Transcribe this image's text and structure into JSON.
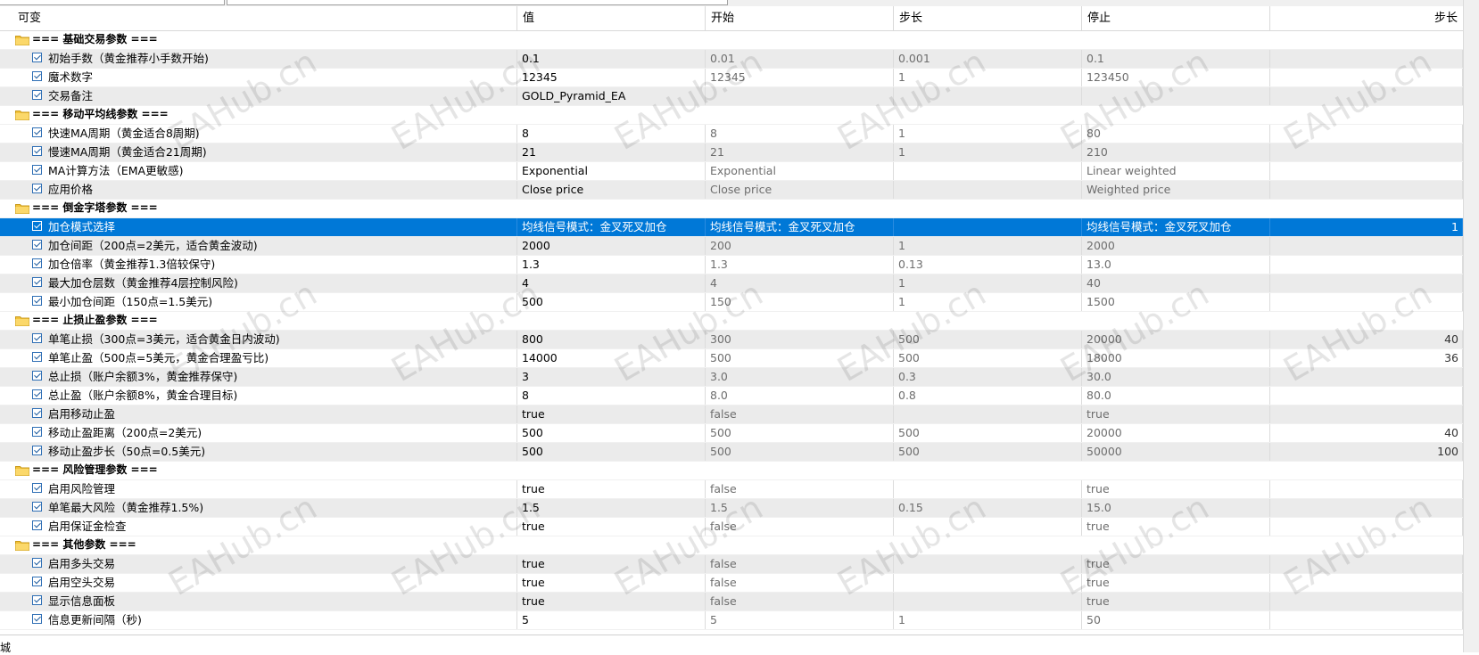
{
  "header": {
    "col_name": "可变",
    "col_value": "值",
    "col_start": "开始",
    "col_step": "步长",
    "col_stop": "停止",
    "col_step2": "步长"
  },
  "groups": [
    {
      "title": "=== 基础交易参数 ===",
      "params": [
        {
          "name": "初始手数（黄金推荐小手数开始)",
          "value": "0.1",
          "start": "0.01",
          "step": "0.001",
          "stop": "0.1",
          "step2": ""
        },
        {
          "name": "魔术数字",
          "value": "12345",
          "start": "12345",
          "step": "1",
          "stop": "123450",
          "step2": ""
        },
        {
          "name": "交易备注",
          "value": "GOLD_Pyramid_EA",
          "start": "",
          "step": "",
          "stop": "",
          "step2": ""
        }
      ]
    },
    {
      "title": "=== 移动平均线参数 ===",
      "params": [
        {
          "name": "快速MA周期（黄金适合8周期)",
          "value": "8",
          "start": "8",
          "step": "1",
          "stop": "80",
          "step2": ""
        },
        {
          "name": "慢速MA周期（黄金适合21周期)",
          "value": "21",
          "start": "21",
          "step": "1",
          "stop": "210",
          "step2": ""
        },
        {
          "name": "MA计算方法（EMA更敏感)",
          "value": "Exponential",
          "start": "Exponential",
          "step": "",
          "stop": "Linear weighted",
          "step2": ""
        },
        {
          "name": "应用价格",
          "value": "Close price",
          "start": "Close price",
          "step": "",
          "stop": "Weighted price",
          "step2": ""
        }
      ]
    },
    {
      "title": "=== 倒金字塔参数 ===",
      "params": [
        {
          "name": "加仓模式选择",
          "value": "均线信号模式：金叉死叉加仓",
          "start": "均线信号模式：金叉死叉加仓",
          "step": "",
          "stop": "均线信号模式：金叉死叉加仓",
          "step2": "1",
          "selected": true
        },
        {
          "name": "加仓间距（200点=2美元，适合黄金波动)",
          "value": "2000",
          "start": "200",
          "step": "1",
          "stop": "2000",
          "step2": ""
        },
        {
          "name": "加仓倍率（黄金推荐1.3倍较保守)",
          "value": "1.3",
          "start": "1.3",
          "step": "0.13",
          "stop": "13.0",
          "step2": ""
        },
        {
          "name": "最大加仓层数（黄金推荐4层控制风险)",
          "value": "4",
          "start": "4",
          "step": "1",
          "stop": "40",
          "step2": ""
        },
        {
          "name": "最小加仓间距（150点=1.5美元)",
          "value": "500",
          "start": "150",
          "step": "1",
          "stop": "1500",
          "step2": ""
        }
      ]
    },
    {
      "title": "=== 止损止盈参数 ===",
      "params": [
        {
          "name": "单笔止损（300点=3美元，适合黄金日内波动)",
          "value": "800",
          "start": "300",
          "step": "500",
          "stop": "20000",
          "step2": "40"
        },
        {
          "name": "单笔止盈（500点=5美元，黄金合理盈亏比)",
          "value": "14000",
          "start": "500",
          "step": "500",
          "stop": "18000",
          "step2": "36"
        },
        {
          "name": "总止损（账户余额3%，黄金推荐保守)",
          "value": "3",
          "start": "3.0",
          "step": "0.3",
          "stop": "30.0",
          "step2": ""
        },
        {
          "name": "总止盈（账户余额8%，黄金合理目标)",
          "value": "8",
          "start": "8.0",
          "step": "0.8",
          "stop": "80.0",
          "step2": ""
        },
        {
          "name": "启用移动止盈",
          "value": "true",
          "start": "false",
          "step": "",
          "stop": "true",
          "step2": ""
        },
        {
          "name": "移动止盈距离（200点=2美元)",
          "value": "500",
          "start": "500",
          "step": "500",
          "stop": "20000",
          "step2": "40"
        },
        {
          "name": "移动止盈步长（50点=0.5美元)",
          "value": "500",
          "start": "500",
          "step": "500",
          "stop": "50000",
          "step2": "100"
        }
      ]
    },
    {
      "title": "=== 风险管理参数 ===",
      "params": [
        {
          "name": "启用风险管理",
          "value": "true",
          "start": "false",
          "step": "",
          "stop": "true",
          "step2": ""
        },
        {
          "name": "单笔最大风险（黄金推荐1.5%)",
          "value": "1.5",
          "start": "1.5",
          "step": "0.15",
          "stop": "15.0",
          "step2": ""
        },
        {
          "name": "启用保证金检查",
          "value": "true",
          "start": "false",
          "step": "",
          "stop": "true",
          "step2": ""
        }
      ]
    },
    {
      "title": "=== 其他参数 ===",
      "params": [
        {
          "name": "启用多头交易",
          "value": "true",
          "start": "false",
          "step": "",
          "stop": "true",
          "step2": ""
        },
        {
          "name": "启用空头交易",
          "value": "true",
          "start": "false",
          "step": "",
          "stop": "true",
          "step2": ""
        },
        {
          "name": "显示信息面板",
          "value": "true",
          "start": "false",
          "step": "",
          "stop": "true",
          "step2": ""
        },
        {
          "name": "信息更新间隔（秒)",
          "value": "5",
          "start": "5",
          "step": "1",
          "stop": "50",
          "step2": ""
        }
      ]
    }
  ],
  "watermark": "EAHub.cn",
  "footer_char": "城",
  "colors": {
    "selection": "#0078d7",
    "alt_row": "#ebebeb",
    "folder": "#f2c23a"
  }
}
